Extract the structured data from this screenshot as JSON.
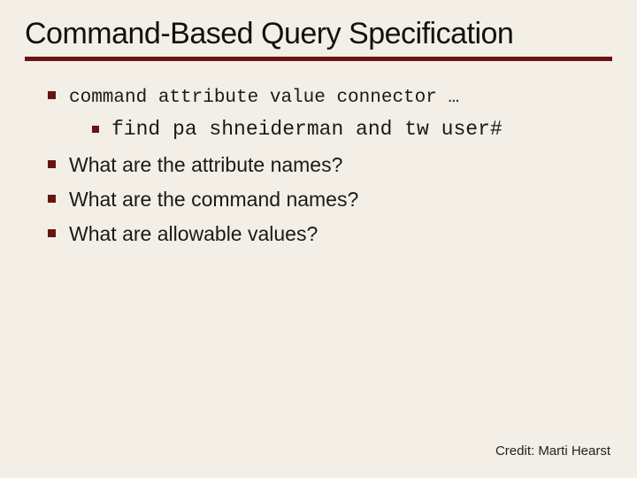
{
  "title": "Command-Based Query Specification",
  "bullets": {
    "b0": "command attribute value connector …",
    "b0_sub0": "find pa shneiderman and tw user#",
    "b1": "What are the attribute names?",
    "b2": "What are the command names?",
    "b3": "What are allowable values?"
  },
  "credit": "Credit: Marti Hearst",
  "colors": {
    "accent": "#6a1313",
    "background": "#f3efe7"
  }
}
